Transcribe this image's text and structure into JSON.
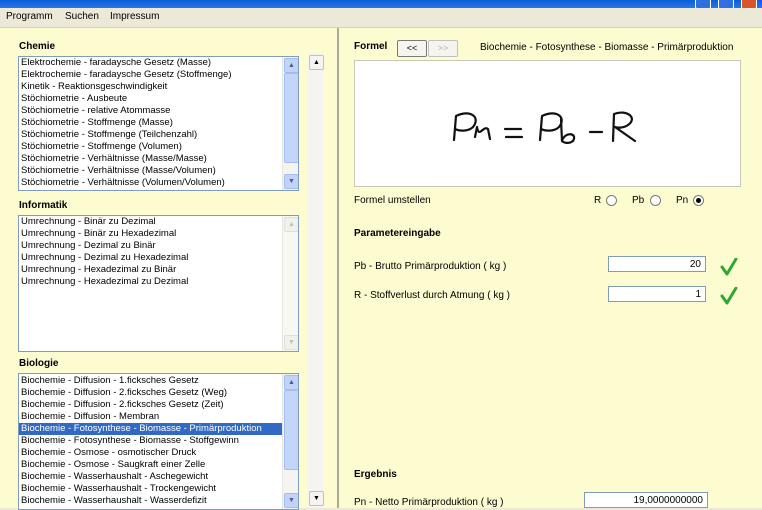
{
  "menu": [
    "Programm",
    "Suchen",
    "Impressum"
  ],
  "chemie": {
    "label": "Chemie",
    "items": [
      "Elektrochemie - faradaysche Gesetz (Masse)",
      "Elektrochemie - faradaysche Gesetz (Stoffmenge)",
      "Kinetik - Reaktionsgeschwindigkeit",
      "Stöchiometrie - Ausbeute",
      "Stöchiometrie - relative Atommasse",
      "Stöchiometrie - Stoffmenge (Masse)",
      "Stöchiometrie - Stoffmenge (Teilchenzahl)",
      "Stöchiometrie - Stoffmenge (Volumen)",
      "Stöchiometrie - Verhältnisse (Masse/Masse)",
      "Stöchiometrie - Verhältnisse (Masse/Volumen)",
      "Stöchiometrie - Verhältnisse (Volumen/Volumen)"
    ]
  },
  "informatik": {
    "label": "Informatik",
    "items": [
      "Umrechnung - Binär zu Dezimal",
      "Umrechnung - Binär zu Hexadezimal",
      "Umrechnung - Dezimal zu Binär",
      "Umrechnung - Dezimal zu Hexadezimal",
      "Umrechnung - Hexadezimal zu Binär",
      "Umrechnung - Hexadezimal zu Dezimal"
    ]
  },
  "biologie": {
    "label": "Biologie",
    "selected_index": 4,
    "items": [
      "Biochemie - Diffusion - 1.ficksches Gesetz",
      "Biochemie - Diffusion - 2.ficksches Gesetz (Weg)",
      "Biochemie - Diffusion - 2.ficksches Gesetz (Zeit)",
      "Biochemie - Diffusion - Membran",
      "Biochemie - Fotosynthese - Biomasse - Primärproduktion",
      "Biochemie - Fotosynthese - Biomasse - Stoffgewinn",
      "Biochemie - Osmose - osmotischer Druck",
      "Biochemie - Osmose - Saugkraft einer Zelle",
      "Biochemie - Wasserhaushalt - Aschegewicht",
      "Biochemie - Wasserhaushalt - Trockengewicht",
      "Biochemie - Wasserhaushalt - Wasserdefizit"
    ]
  },
  "formel": {
    "label": "Formel",
    "prev_label": "<<",
    "next_label": ">>",
    "title": "Biochemie - Fotosynthese - Biomasse - Primärproduktion"
  },
  "umstellen": {
    "label": "Formel umstellen",
    "options": [
      {
        "label": "R",
        "selected": false
      },
      {
        "label": "Pb",
        "selected": false
      },
      {
        "label": "Pn",
        "selected": true
      }
    ]
  },
  "parameter": {
    "heading": "Parametereingabe",
    "rows": [
      {
        "label": "Pb - Brutto Primärproduktion ( kg )",
        "value": "20"
      },
      {
        "label": "R - Stoffverlust durch Atmung ( kg )",
        "value": "1"
      }
    ]
  },
  "ergebnis": {
    "heading": "Ergebnis",
    "label": "Pn - Netto Primärproduktion ( kg )",
    "value": "19,0000000000"
  },
  "colors": {
    "client_bg": "#fdfbd0",
    "selection": "#316ac5",
    "check": "#2fa82f"
  }
}
